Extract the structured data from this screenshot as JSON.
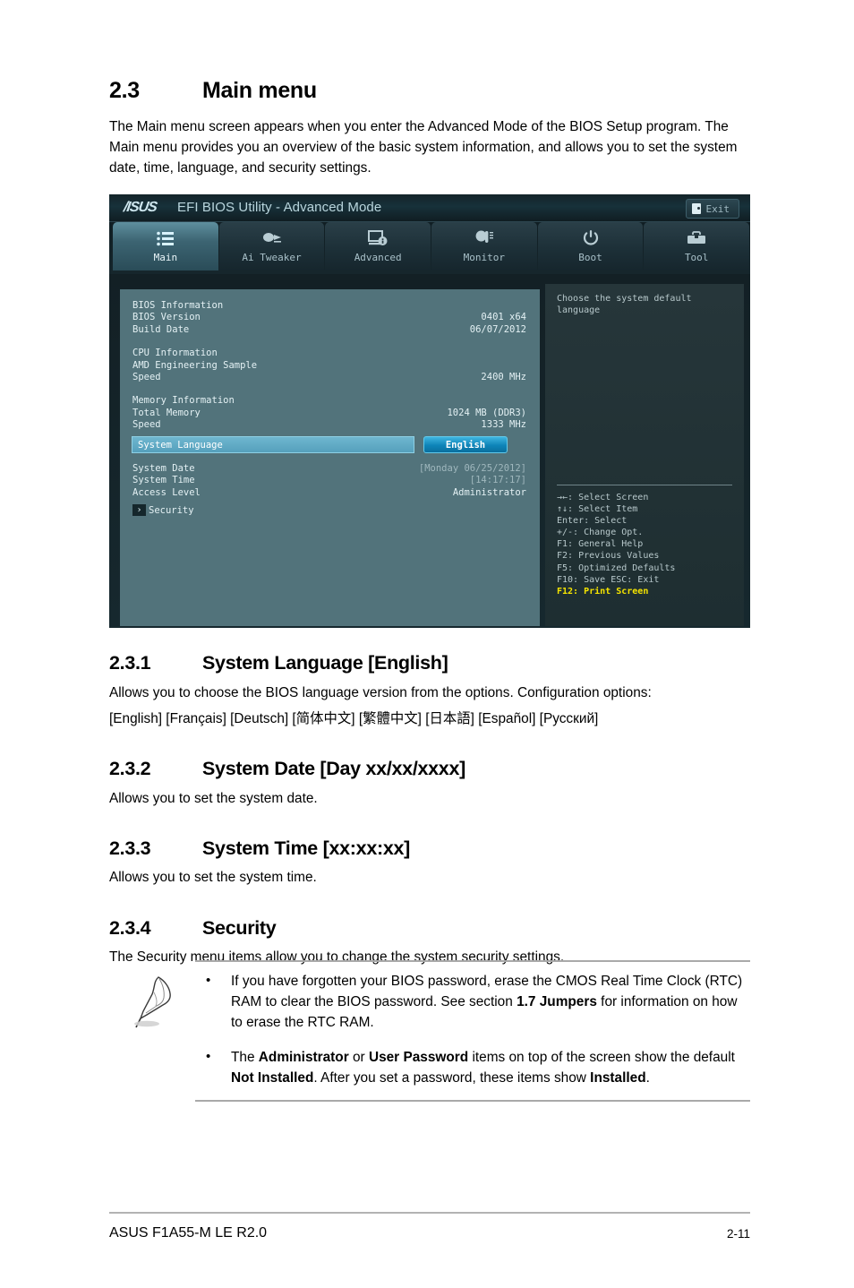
{
  "document": {
    "section": {
      "number": "2.3",
      "title": "Main menu"
    },
    "intro": "The Main menu screen appears when you enter the Advanced Mode of the BIOS Setup program. The Main menu provides you an overview of the basic system information, and allows you to set the system date, time, language, and security settings.",
    "subsections": [
      {
        "number": "2.3.1",
        "title": "System Language [English]",
        "body_line1": "Allows you to choose the BIOS language version from the options. Configuration options:",
        "body_line2": "[English] [Français] [Deutsch] [简体中文] [繁體中文] [日本語] [Español] [Русский]"
      },
      {
        "number": "2.3.2",
        "title": "System Date [Day xx/xx/xxxx]",
        "body_line1": "Allows you to set the system date."
      },
      {
        "number": "2.3.3",
        "title": "System Time [xx:xx:xx]",
        "body_line1": "Allows you to set the system time."
      },
      {
        "number": "2.3.4",
        "title": "Security",
        "body_line1": "The Security menu items allow you to change the system security settings."
      }
    ],
    "note": {
      "bullet_glyph": "•",
      "items": [
        {
          "p1": "If you have forgotten your BIOS password, erase the CMOS Real Time Clock (RTC) RAM to clear the BIOS password. See section ",
          "b1": "1.7 Jumpers",
          "p2": " for information on how to erase the RTC RAM."
        },
        {
          "p1": "The ",
          "b1": "Administrator",
          "p2": " or ",
          "b2": "User Password",
          "p3": " items on top of the screen show the default ",
          "b3": "Not Installed",
          "p4": ". After you set a password, these items show ",
          "b4": "Installed",
          "p5": "."
        }
      ]
    },
    "footer": {
      "left": "ASUS F1A55-M LE R2.0",
      "right": "2-11"
    }
  },
  "bios": {
    "logo": "/ISUS",
    "title": "EFI BIOS Utility - Advanced Mode",
    "exit_label": "Exit",
    "tabs": [
      {
        "label": "Main",
        "icon": "list-icon",
        "active": true
      },
      {
        "label": "Ai Tweaker",
        "icon": "tuner-icon",
        "active": false
      },
      {
        "label": "Advanced",
        "icon": "monitor-info-icon",
        "active": false
      },
      {
        "label": "Monitor",
        "icon": "thermometer-icon",
        "active": false
      },
      {
        "label": "Boot",
        "icon": "power-icon",
        "active": false
      },
      {
        "label": "Tool",
        "icon": "toolbox-icon",
        "active": false
      }
    ],
    "info_groups": [
      {
        "heading": "BIOS Information",
        "rows": [
          {
            "label": "BIOS Version",
            "value": "0401 x64"
          },
          {
            "label": "Build Date",
            "value": "06/07/2012"
          }
        ]
      },
      {
        "heading": "CPU Information",
        "subheading": "AMD Engineering Sample",
        "rows": [
          {
            "label": "Speed",
            "value": "2400 MHz"
          }
        ]
      },
      {
        "heading": "Memory Information",
        "rows": [
          {
            "label": "Total Memory",
            "value": "1024 MB (DDR3)"
          },
          {
            "label": "Speed",
            "value": "1333 MHz"
          }
        ]
      }
    ],
    "language_row": {
      "label": "System Language",
      "value": "English"
    },
    "datetime_rows": [
      {
        "label": "System Date",
        "value": "[Monday 06/25/2012]",
        "dim": true
      },
      {
        "label": "System Time",
        "value": "[14:17:17]",
        "dim": true
      },
      {
        "label": "Access Level",
        "value": "Administrator",
        "dim": false
      }
    ],
    "security_entry": {
      "arrow": "›",
      "label": "Security"
    },
    "help_text": "Choose the system default language",
    "key_legend": [
      {
        "text": "→←: Select Screen",
        "highlight": false
      },
      {
        "text": "↑↓: Select Item",
        "highlight": false
      },
      {
        "text": "Enter: Select",
        "highlight": false
      },
      {
        "text": "+/-: Change Opt.",
        "highlight": false
      },
      {
        "text": "F1: General Help",
        "highlight": false
      },
      {
        "text": "F2: Previous Values",
        "highlight": false
      },
      {
        "text": "F5: Optimized Defaults",
        "highlight": false
      },
      {
        "text": "F10: Save  ESC: Exit",
        "highlight": false
      },
      {
        "text": "F12: Print Screen",
        "highlight": true
      }
    ]
  },
  "colors": {
    "panel_bg": "#52737b",
    "help_bg": "#26363a",
    "highlight": "#55a0bc",
    "value_btn": "#0e84b8",
    "hotkey": "#f5e400"
  }
}
